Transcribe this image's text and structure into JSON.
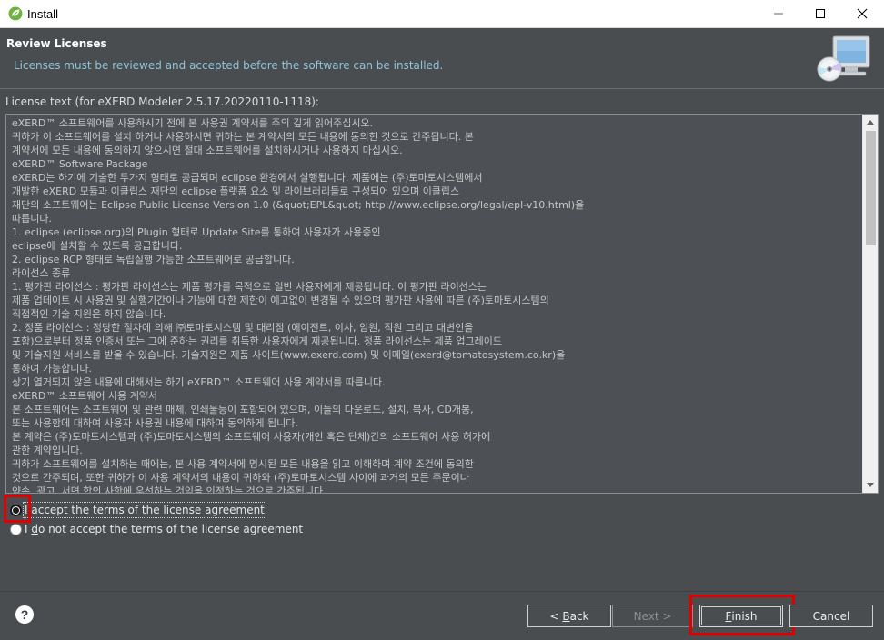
{
  "window": {
    "title": "Install"
  },
  "header": {
    "title": "Review Licenses",
    "message": "Licenses must be reviewed and accepted before the software can be installed."
  },
  "license": {
    "label": "License text (for eXERD Modeler 2.5.17.20220110-1118):",
    "lines": [
      "eXERD™ 소프트웨어를 사용하시기 전에 본 사용권 계약서를 주의 깊게 읽어주십시오.",
      "귀하가 이 소프트웨어를 설치 하거나 사용하시면 귀하는 본 계약서의 모든 내용에 동의한 것으로 간주됩니다. 본",
      "계약서에 모든 내용에 동의하지 않으시면 절대 소프트웨어를 설치하시거나 사용하지 마십시오.",
      "eXERD™ Software Package",
      "eXERD는 하기에 기술한 두가지 형태로 공급되며 eclipse 환경에서 실행됩니다. 제품에는 (주)토마토시스템에서",
      "개발한 eXERD 모듈과 이클립스 재단의 eclipse 플랫폼 요소 및 라이브러리들로 구성되어 있으며 이클립스",
      "재단의 소프트웨어는 Eclipse Public License Version 1.0 (&quot;EPL&quot; http://www.eclipse.org/legal/epl-v10.html)을",
      "따릅니다.",
      "1. eclipse (eclipse.org)의 Plugin 형태로 Update Site를 통하여 사용자가 사용중인",
      "eclipse에 설치할 수 있도록 공급합니다.",
      "2. eclipse RCP 형태로 독립실행 가능한 소프트웨어로 공급합니다.",
      "라이선스 종류",
      "1. 평가판 라이선스 : 평가판 라이선스는 제품 평가를 목적으로 일반 사용자에게 제공됩니다. 이 평가판 라이선스는",
      "제품 업데이트 시 사용권 및 실행기간이나 기능에 대한 제한이 예고없이 변경될 수 있으며 평가판 사용에 따른 (주)토마토시스템의",
      "직접적인 기술 지원은 하지 않습니다.",
      "2. 정품 라이선스 : 정당한 절차에 의해 ㈜토마토시스템 및 대리점 (에이전트, 이사, 임원, 직원 그리고 대변인을",
      "포함)으로부터 정품 인증서 또는 그에 준하는 권리를 취득한 사용자에게 제공됩니다. 정품 라이선스는 제품 업그레이드",
      "및 기술지원 서비스를 받을 수 있습니다. 기술지원은 제품 사이트(www.exerd.com) 및 이메일(exerd@tomatosystem.co.kr)을",
      "통하여 가능합니다.",
      "상기 열거되지 않은 내용에 대해서는 하기 eXERD™ 소프트웨어 사용 계약서를 따릅니다.",
      "eXERD™ 소프트웨어 사용 계약서",
      "본 소프트웨어는 소프트웨어 및 관련 매체, 인쇄물등이 포함되어 있으며, 이들의 다운로드, 설치, 복사, CD개봉,",
      "또는 사용함에 대하여 사용자 사용권 내용에 대하여 동의하게 됩니다.",
      "본 계약은 (주)토마토시스템과 (주)토마토시스템의 소프트웨어 사용자(개인 혹은 단체)간의 소프트웨어 사용 허가에",
      "관한 계약입니다.",
      "귀하가 소프트웨어를 설치하는 때에는, 본 사용 계약서에 명시된 모든 내용을 읽고 이해하며 계약 조건에 동의한",
      "것으로 간주되며, 또한 귀하가 이 사용 계약서의 내용이 귀하와 (주)토마토시스템 사이에 과거의 모든 주문이나",
      "약속, 광고, 서면 합의 사항에 우선하는 것임을 인정하는 것으로 간주됩니다."
    ]
  },
  "options": {
    "accept_prefix": "I ",
    "accept_mnemonic": "a",
    "accept_rest": "ccept the terms of the license agreement",
    "decline_prefix": "I ",
    "decline_mnemonic": "d",
    "decline_rest": "o not accept the terms of the license agreement",
    "selected": "accept"
  },
  "buttons": {
    "help": "?",
    "back_prefix": "< ",
    "back_mnemonic": "B",
    "back_rest": "ack",
    "next": "Next >",
    "finish_mnemonic": "F",
    "finish_rest": "inish",
    "cancel": "Cancel"
  },
  "colors": {
    "background": "#4a4d50",
    "header_message": "#8fc4d9",
    "highlight_box": "#e00000"
  },
  "icons": {
    "app": "eclipse-spring-leaf-icon",
    "banner": "computer-cd-install-icon"
  }
}
